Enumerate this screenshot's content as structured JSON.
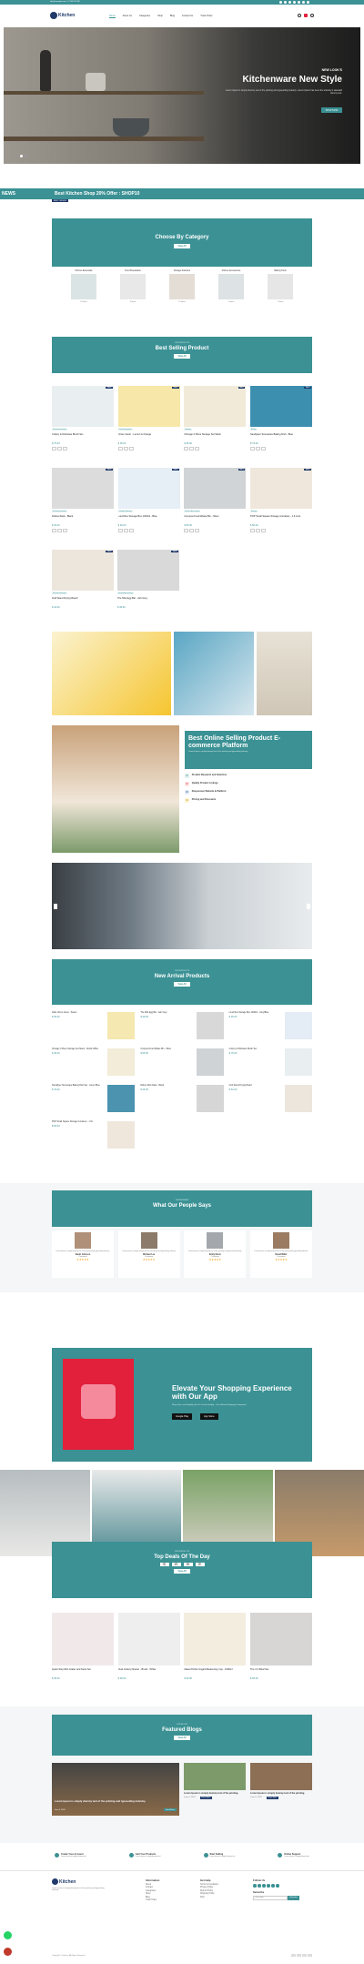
{
  "topbar": {
    "contact": "info@example.com | +1 234 567 890"
  },
  "header": {
    "brand": "Kitchen",
    "nav": [
      "Home",
      "About Us",
      "Categories",
      "Shop",
      "Blog",
      "Contact Us",
      "Track Order"
    ]
  },
  "hero": {
    "eyebrow": "NEW LOOK'S",
    "title": "Kitchenware New Style",
    "text": "Lorem Ipsum is simply dummy text of the printing and typesetting industry. Lorem Ipsum has been the industry's standard dummy text.",
    "button": "SHOP NOW"
  },
  "ticker": {
    "left": "NEWS",
    "text": "Best Kitchen Shop 20% Offer : SHOP10",
    "badge": "BEST OFFERS"
  },
  "category": {
    "title": "Choose By Category",
    "button": "View All",
    "items": [
      "Kitchen Essentials",
      "Food Preparation",
      "Storage Solutions",
      "Kitchen Accessories",
      "Baking Tools"
    ],
    "counts": [
      "10 Items",
      "8 Items",
      "12 Items",
      "9 Items",
      "7 Items"
    ]
  },
  "best": {
    "label": "OUR PRODUCTS",
    "title": "Best Selling Product",
    "button": "View All",
    "products": [
      {
        "name": "Cutlery & Dishware Brush Set",
        "price": "$ 75.00",
        "tag": "Kitchen Essentials",
        "sale": "SALE"
      },
      {
        "name": "Citrus Juicer - Lemon & Orange",
        "price": "$ 35.00",
        "tag": "Food Preparation",
        "sale": "SALE"
      },
      {
        "name": "Chicago 3 Piece Storage Set Stack",
        "price": "$ 45.00",
        "tag": "Storage",
        "sale": "SALE"
      },
      {
        "name": "Sandpiper Stoneware Baking Dish - Blue",
        "price": "$ 79.00",
        "tag": "Baking",
        "sale": "SALE"
      },
      {
        "name": "Dishes Rack - Black",
        "price": "$ 25.00",
        "tag": "Kitchen Essentials",
        "sale": "SALE"
      },
      {
        "name": "Lunchbox Storage Box 1300ml - Blue",
        "price": "$ 30.00",
        "tag": "Storage Solutions",
        "sale": "SALE"
      },
      {
        "name": "Compost Food Waste Bin - Silver",
        "price": "$ 65.00",
        "tag": "Kitchen Accessories",
        "sale": "SALE"
      },
      {
        "name": "POP Small Square Storage Container - 1.6 Litre",
        "price": "$ 50.00",
        "tag": "Storage",
        "sale": "SALE"
      },
      {
        "name": "Grid Stand Drying Board",
        "price": "$ 42.00",
        "tag": "Kitchen Essentials",
        "sale": "SALE"
      },
      {
        "name": "The Mini Egg Bar - Ash Grey",
        "price": "$ 49.00",
        "tag": "Kitchen Accessories",
        "sale": "SALE"
      }
    ]
  },
  "platform": {
    "title": "Best Online Selling Product E-commerce Platform",
    "text": "Lorem Ipsum is simply dummy text of the printing and typesetting industry.",
    "items": [
      {
        "num": "01",
        "title": "Product Research and Selection"
      },
      {
        "num": "02",
        "title": "Quality Product Listings"
      },
      {
        "num": "03",
        "title": "Responsive Website & Platform"
      },
      {
        "num": "04",
        "title": "Pricing and Discounts"
      }
    ]
  },
  "arrival": {
    "label": "OUR PRODUCTS",
    "title": "New Arrival Products",
    "button": "View All",
    "products": [
      {
        "name": "Glide Citrus Juicer - Steam",
        "price": "$ 35.00"
      },
      {
        "name": "The Mini Egg Bar - Ash Grey",
        "price": "$ 49.00"
      },
      {
        "name": "Lunchbox Storage Box 1300ml - Grey/Blue",
        "price": "$ 30.00"
      },
      {
        "name": "Chicago 3 Piece Storage Set Stack - Nordic White",
        "price": "$ 45.00"
      },
      {
        "name": "Compost Food Waste Bin - Silver",
        "price": "$ 65.00"
      },
      {
        "name": "Cutlery & Dishware Brush Set",
        "price": "$ 75.00"
      },
      {
        "name": "Sandpiper Stoneware Baking Dish Set - Green Blue",
        "price": "$ 79.00"
      },
      {
        "name": "Dishes Dish Rack - Black",
        "price": "$ 25.00"
      },
      {
        "name": "Grid Stand Drying Board",
        "price": "$ 42.00"
      },
      {
        "name": "POP Small Square Storage Container - 1.6L",
        "price": "$ 50.00"
      }
    ]
  },
  "testimonials": {
    "label": "TESTIMONIALS",
    "title": "What Our People Says",
    "text": "Lorem Ipsum is simply dummy text of the printing and typesetting industry.",
    "names": [
      "Sarah Johnson",
      "Michael Lee",
      "Emily Davis",
      "David Miller"
    ],
    "roles": [
      "Customer",
      "Customer",
      "Customer",
      "Customer"
    ]
  },
  "app": {
    "title": "Elevate Your Shopping Experience with Our App",
    "text": "Shop, Save, and Simplify with Our On-the-Go App – Your Ultimate Shopping Companion!",
    "google": "Google Play",
    "apple": "App Store"
  },
  "deals": {
    "label": "OUR PRODUCTS",
    "title": "Top Deals Of The Day",
    "button": "View All",
    "timer": [
      {
        "v": "00",
        "l": "Days"
      },
      {
        "v": "00",
        "l": "Hours"
      },
      {
        "v": "00",
        "l": "Mins"
      },
      {
        "v": "00",
        "l": "Secs"
      }
    ],
    "products": [
      {
        "name": "Quick Stop Mini Grater and Store Set",
        "price": "$ 35.00"
      },
      {
        "name": "Dual Cutlery Drainer - Brush - White",
        "price": "$ 28.00"
      },
      {
        "name": "Glass Pitcher Angled Measuring Cup - 1000ml",
        "price": "$ 30.00"
      },
      {
        "name": "The 4 in Bowl Set",
        "price": "$ 55.00"
      }
    ]
  },
  "blog": {
    "label": "OUR BLOGS",
    "title": "Featured Blogs",
    "button": "View All",
    "posts": [
      {
        "title": "Lorem Ipsum is simply dummy text of the printing and typesetting industry.",
        "date": "June 6, 2024",
        "more": "Read More"
      },
      {
        "title": "Lorem Ipsum is simply dummy text of the printing.",
        "date": "June 6, 2024",
        "more": "Read More"
      },
      {
        "title": "Lorem Ipsum is simply dummy text of the printing.",
        "date": "June 6, 2024",
        "more": "Read More"
      }
    ]
  },
  "features": [
    {
      "title": "Create Your Account",
      "text": "Lorem Ipsum is simply dummy text"
    },
    {
      "title": "Add Your Products",
      "text": "Lorem Ipsum is simply dummy text"
    },
    {
      "title": "Start Selling",
      "text": "Lorem Ipsum is simply dummy text"
    },
    {
      "title": "Online Support",
      "text": "Lorem Ipsum is simply dummy text"
    }
  ],
  "footer": {
    "brand": "Kitchen",
    "about": "Lorem Ipsum is simply dummy text of the printing and typesetting industry.",
    "col1": {
      "title": "Information",
      "links": [
        "About",
        "Contact",
        "Categories",
        "Shop",
        "Blog",
        "Track Order"
      ]
    },
    "col2": {
      "title": "Get Help",
      "links": [
        "Terms & Conditions",
        "Privacy Policy",
        "Refund Policy",
        "Shipping Policy",
        "FAQ"
      ]
    },
    "col3": {
      "title": "Follow Us",
      "sub": "Subscribe",
      "placeholder": "Your email",
      "button": "Subscribe"
    },
    "copyright": "Copyright © Kitchen. All Rights Reserved"
  },
  "colors": {
    "accent": "#3b9194",
    "navy": "#1f3a6b",
    "appbg": "#e2203b"
  }
}
